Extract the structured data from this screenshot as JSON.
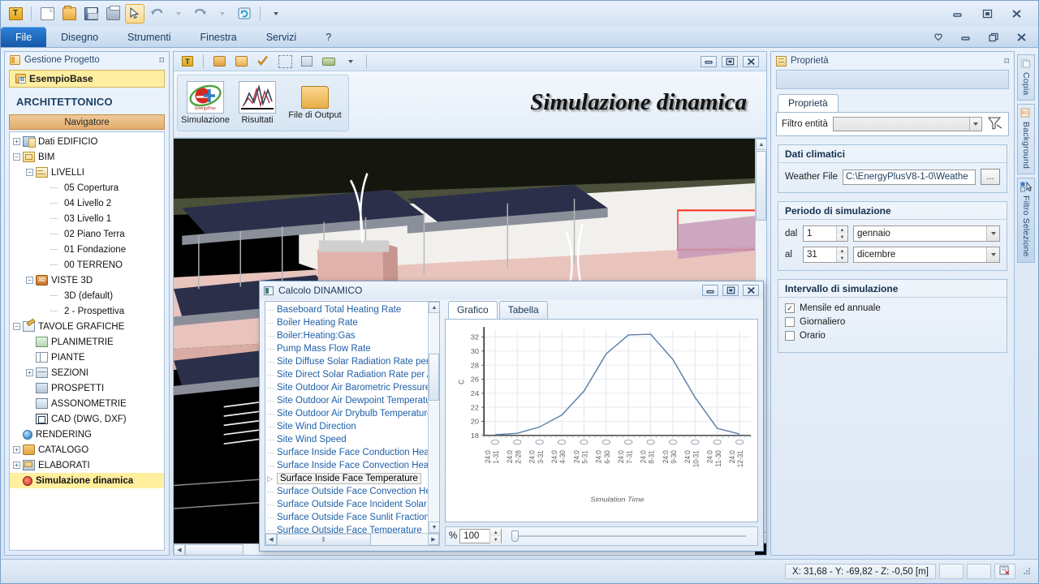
{
  "window": {
    "app_icon": "app-icon",
    "minimize": "–",
    "restore": "❐",
    "close": "✕",
    "heart": "♡"
  },
  "toolbar": {
    "buttons": [
      {
        "name": "app-menu-icon",
        "label": "T"
      },
      {
        "name": "new-document-icon",
        "label": ""
      },
      {
        "name": "open-folder-icon",
        "label": ""
      },
      {
        "name": "save-icon",
        "label": ""
      },
      {
        "name": "print-icon",
        "label": ""
      },
      {
        "name": "select-cursor-icon",
        "label": ""
      },
      {
        "name": "undo-icon",
        "label": ""
      },
      {
        "name": "redo-icon",
        "label": ""
      },
      {
        "name": "refresh-icon",
        "label": ""
      },
      {
        "name": "toolbar-overflow-icon",
        "label": ""
      }
    ]
  },
  "menubar": {
    "items": [
      {
        "label": "File",
        "active": true
      },
      {
        "label": "Disegno",
        "active": false
      },
      {
        "label": "Strumenti",
        "active": false
      },
      {
        "label": "Finestra",
        "active": false
      },
      {
        "label": "Servizi",
        "active": false
      },
      {
        "label": "?",
        "active": false
      }
    ]
  },
  "sidebar": {
    "title": "Gestione Progetto",
    "pin": "⌑",
    "project": "EsempioBase",
    "section": "ARCHITETTONICO",
    "navigator_button": "Navigatore",
    "tree": [
      {
        "label": "Dati EDIFICIO",
        "indent": 0,
        "expander": "+",
        "icon": "building-icon"
      },
      {
        "label": "BIM",
        "indent": 0,
        "expander": "−",
        "icon": "bim-icon"
      },
      {
        "label": "LIVELLI",
        "indent": 1,
        "expander": "−",
        "icon": "levels-icon"
      },
      {
        "label": "05 Copertura",
        "indent": 2,
        "expander": "",
        "icon": "leaf-icon"
      },
      {
        "label": "04 Livello 2",
        "indent": 2,
        "expander": "",
        "icon": "leaf-icon"
      },
      {
        "label": "03 Livello 1",
        "indent": 2,
        "expander": "",
        "icon": "leaf-icon"
      },
      {
        "label": "02 Piano Terra",
        "indent": 2,
        "expander": "",
        "icon": "leaf-icon"
      },
      {
        "label": "01 Fondazione",
        "indent": 2,
        "expander": "",
        "icon": "leaf-icon"
      },
      {
        "label": "00 TERRENO",
        "indent": 2,
        "expander": "",
        "icon": "leaf-icon"
      },
      {
        "label": "VISTE 3D",
        "indent": 1,
        "expander": "−",
        "icon": "view3d-icon"
      },
      {
        "label": "3D (default)",
        "indent": 2,
        "expander": "",
        "icon": "leaf-icon"
      },
      {
        "label": "2 - Prospettiva",
        "indent": 2,
        "expander": "",
        "icon": "leaf-icon"
      },
      {
        "label": "TAVOLE GRAFICHE",
        "indent": 0,
        "expander": "−",
        "icon": "pencil-icon"
      },
      {
        "label": "PLANIMETRIE",
        "indent": 1,
        "expander": "",
        "icon": "site-plan-icon"
      },
      {
        "label": "PIANTE",
        "indent": 1,
        "expander": "",
        "icon": "floor-plan-icon"
      },
      {
        "label": "SEZIONI",
        "indent": 1,
        "expander": "+",
        "icon": "sections-icon"
      },
      {
        "label": "PROSPETTI",
        "indent": 1,
        "expander": "",
        "icon": "elevations-icon"
      },
      {
        "label": "ASSONOMETRIE",
        "indent": 1,
        "expander": "",
        "icon": "axonometry-icon"
      },
      {
        "label": "CAD (DWG, DXF)",
        "indent": 1,
        "expander": "",
        "icon": "cad-icon"
      },
      {
        "label": "RENDERING",
        "indent": 0,
        "expander": "",
        "icon": "rendering-icon"
      },
      {
        "label": "CATALOGO",
        "indent": 0,
        "expander": "+",
        "icon": "catalog-icon"
      },
      {
        "label": "ELABORATI",
        "indent": 0,
        "expander": "+",
        "icon": "documents-icon"
      },
      {
        "label": "Simulazione dinamica",
        "indent": 0,
        "expander": "",
        "icon": "simulation-icon",
        "highlight": true
      }
    ]
  },
  "ribbon": {
    "title": "Simulazione dinamica",
    "buttons": [
      {
        "label": "Simulazione",
        "icon": "energyplus-icon"
      },
      {
        "label": "Risultati",
        "icon": "results-chart-icon"
      },
      {
        "label": "File di Output",
        "icon": "output-folder-icon"
      }
    ],
    "small_icons": [
      "entity-icon",
      "box-icon",
      "open-box-icon",
      "check-icon",
      "selection-icon",
      "solid-icon",
      "layers-icon",
      "dropdown-icon"
    ]
  },
  "properties": {
    "title": "Proprietà",
    "pin": "⌑",
    "tab": "Proprietà",
    "filter_label": "Filtro entità",
    "filter_value": "",
    "filter_icon": "funnel-icon",
    "climate": {
      "title": "Dati climatici",
      "weather_label": "Weather File",
      "weather_value": "C:\\EnergyPlusV8-1-0\\Weathe",
      "browse_label": "..."
    },
    "period": {
      "title": "Periodo di simulazione",
      "from_label": "dal",
      "from_day": "1",
      "from_month": "gennaio",
      "to_label": "al",
      "to_day": "31",
      "to_month": "dicembre"
    },
    "interval": {
      "title": "Intervallo di simulazione",
      "options": [
        {
          "label": "Mensile ed annuale",
          "checked": true
        },
        {
          "label": "Giornaliero",
          "checked": false
        },
        {
          "label": "Orario",
          "checked": false
        }
      ]
    }
  },
  "vertical_tabs": [
    {
      "label": "Copia",
      "icon": "copy-icon",
      "active": false
    },
    {
      "label": "Background",
      "icon": "background-icon",
      "active": false
    },
    {
      "label": "Filtro Selezione",
      "icon": "selection-filter-icon",
      "active": true
    }
  ],
  "dialog": {
    "title": "Calcolo DINAMICO",
    "variables": [
      "Baseboard Total Heating Rate",
      "Boiler Heating Rate",
      "Boiler:Heating:Gas",
      "Pump Mass Flow Rate",
      "Site Diffuse Solar Radiation Rate per A",
      "Site Direct Solar Radiation Rate per Are",
      "Site Outdoor Air Barometric Pressure",
      "Site Outdoor Air Dewpoint Temperature",
      "Site Outdoor Air Drybulb Temperature",
      "Site Wind Direction",
      "Site Wind Speed",
      "Surface Inside Face Conduction Heat T",
      "Surface Inside Face Convection Heat T",
      "Surface Inside Face Temperature",
      "Surface Outside Face Convection Heat",
      "Surface Outside Face Incident Solar Ra",
      "Surface Outside Face Sunlit Fraction",
      "Surface Outside Face Temperature"
    ],
    "selected_variable": "Surface Inside Face Temperature",
    "tabs": [
      {
        "label": "Grafico",
        "active": true
      },
      {
        "label": "Tabella",
        "active": false
      }
    ],
    "zoom": {
      "unit": "%",
      "value": "100"
    }
  },
  "chart_data": {
    "type": "line",
    "title": "",
    "xlabel": "Simulation Time",
    "ylabel": "C",
    "ylim": [
      18,
      33
    ],
    "yticks": [
      18,
      20,
      22,
      24,
      26,
      28,
      30,
      32
    ],
    "grid": true,
    "legend": "none",
    "categories": [
      "1-31 24:0",
      "2-28 24:0",
      "3-31 24:0",
      "4-30 24:0",
      "5-31 24:0",
      "6-30 24:0",
      "7-31 24:0",
      "8-31 24:0",
      "9-30 24:0",
      "10-31 24:0",
      "11-30 24:0",
      "12-31 24:0"
    ],
    "series": [
      {
        "name": "Surface Inside Face Temperature",
        "color": "#5c7fa8",
        "values": [
          18.1,
          18.3,
          19.2,
          20.9,
          24.3,
          29.6,
          32.3,
          32.4,
          28.8,
          23.4,
          19.0,
          18.2
        ]
      }
    ]
  },
  "statusbar": {
    "coordinates": "X: 31,68 - Y: -69,82 - Z: -0,50 [m]",
    "icon": "snap-icon"
  }
}
